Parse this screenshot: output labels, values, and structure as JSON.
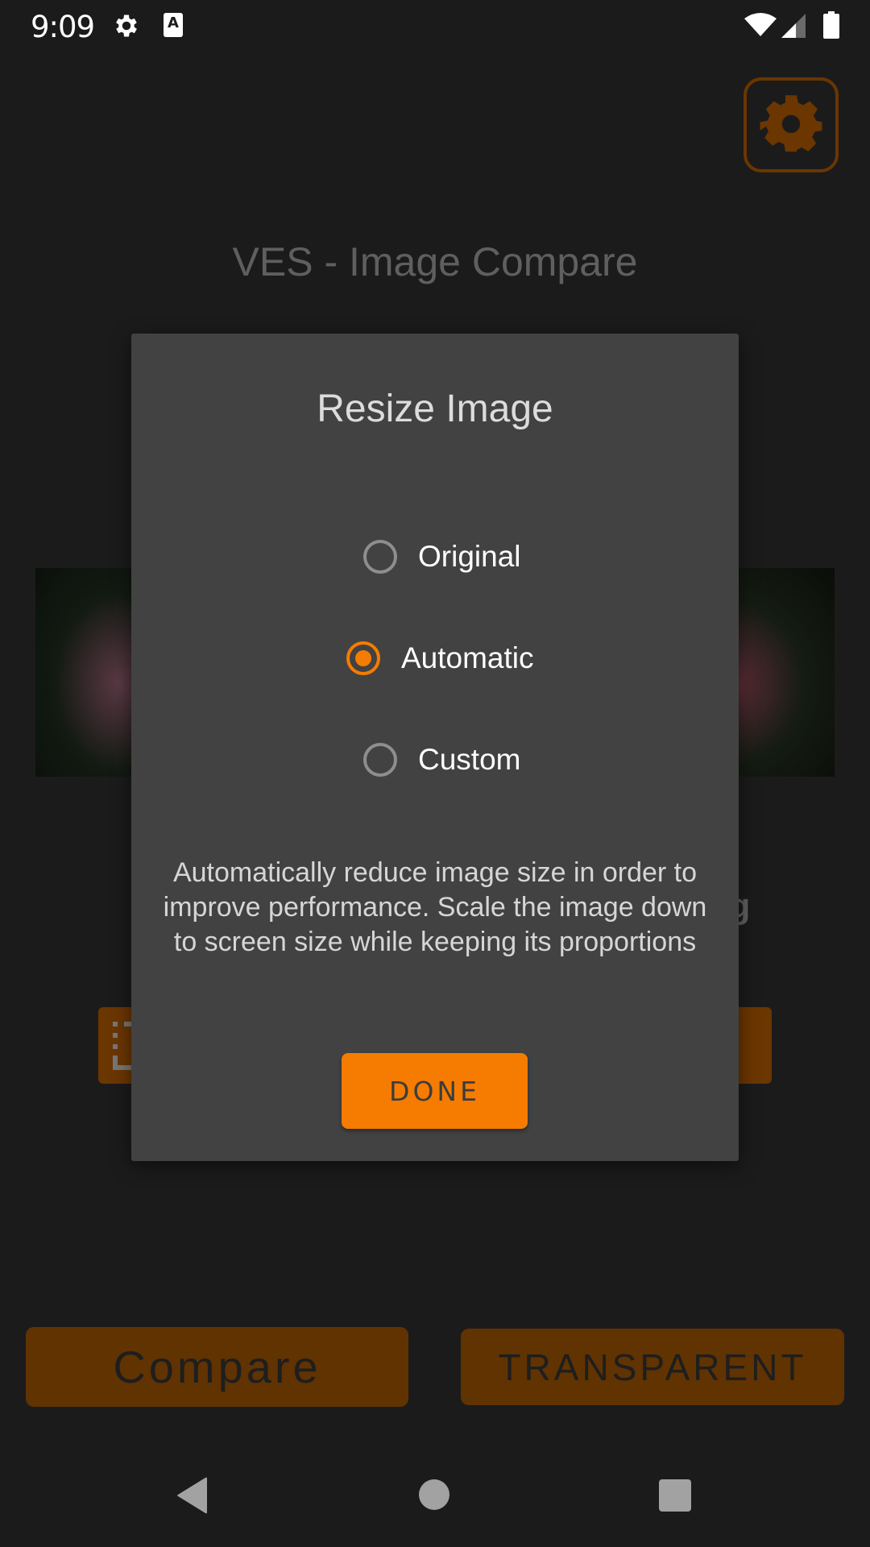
{
  "status_bar": {
    "time": "9:09",
    "notification_icons": [
      "gear-icon",
      "a-keyboard-icon"
    ],
    "system_icons": [
      "wifi-icon",
      "signal-icon",
      "battery-icon"
    ],
    "a_icon_text": "A"
  },
  "app": {
    "title": "VES - Image Compare",
    "settings_icon": "gear-icon",
    "right_filename_fragment": "eg",
    "bottom_buttons": {
      "compare_label": "Compare",
      "transparent_label": "TRANSPARENT"
    },
    "accent_color": "#f57c00"
  },
  "dialog": {
    "title": "Resize Image",
    "options": [
      {
        "label": "Original",
        "selected": false
      },
      {
        "label": "Automatic",
        "selected": true
      },
      {
        "label": "Custom",
        "selected": false
      }
    ],
    "description": "Automatically reduce image size in order to improve performance. Scale the image down to screen size while keeping its proportions",
    "done_label": "DONE"
  },
  "nav_bar": {
    "buttons": [
      "back",
      "home",
      "recents"
    ]
  }
}
